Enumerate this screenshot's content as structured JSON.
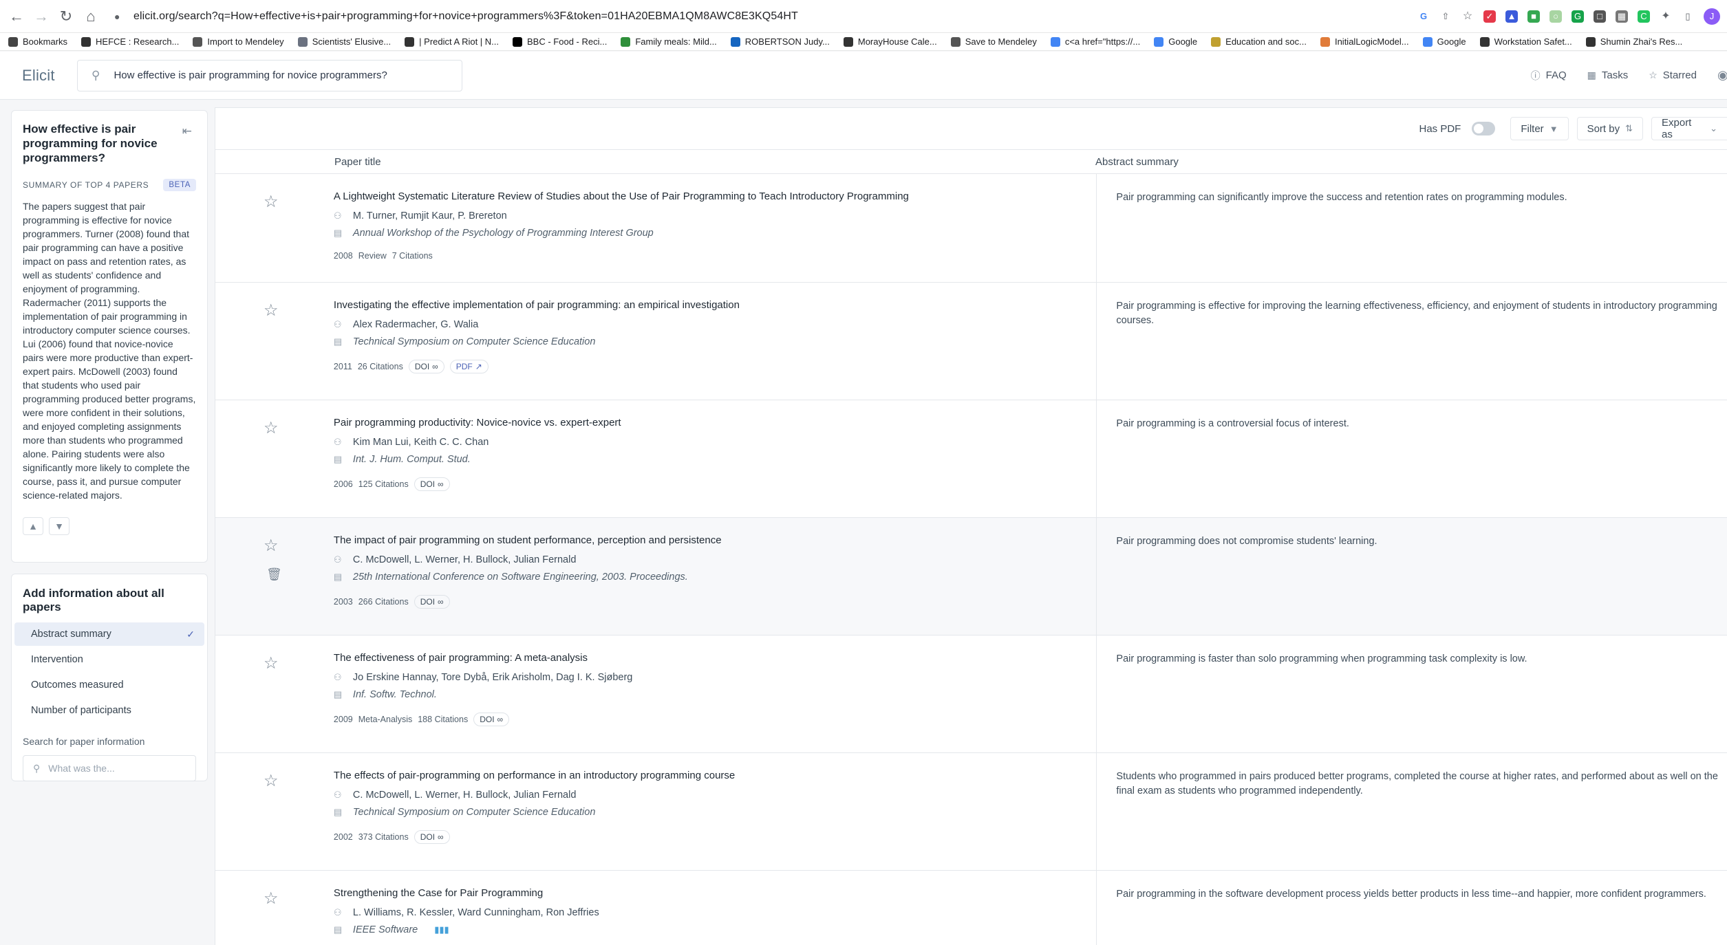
{
  "browser": {
    "url": "elicit.org/search?q=How+effective+is+pair+programming+for+novice+programmers%3F&token=01HA20EBMA1QM8AWC8E3KQ54HT",
    "profile_initial": "J",
    "bookmarks": [
      {
        "label": "Bookmarks",
        "icon": "star-icon"
      },
      {
        "label": "HEFCE : Research...",
        "icon": "folder-icon"
      },
      {
        "label": "Import to Mendeley",
        "icon": "mendeley-icon"
      },
      {
        "label": "Scientists' Elusive...",
        "icon": "ku-icon"
      },
      {
        "label": "| Predict A Riot | N...",
        "icon": "page-icon"
      },
      {
        "label": "BBC - Food - Reci...",
        "icon": "bbc-icon"
      },
      {
        "label": "Family meals: Mild...",
        "icon": "guardian-icon"
      },
      {
        "label": "ROBERTSON Judy...",
        "icon": "outlook-icon"
      },
      {
        "label": "MorayHouse Cale...",
        "icon": "calendar-icon"
      },
      {
        "label": "Save to Mendeley",
        "icon": "mendeley-icon"
      },
      {
        "label": "c<a href=\"https://...",
        "icon": "google-icon"
      },
      {
        "label": "Google",
        "icon": "google-icon"
      },
      {
        "label": "Education and soc...",
        "icon": "page-icon"
      },
      {
        "label": "InitialLogicModel...",
        "icon": "page-icon"
      },
      {
        "label": "Google",
        "icon": "google-icon"
      },
      {
        "label": "Workstation Safet...",
        "icon": "globe-icon"
      },
      {
        "label": "Shumin Zhai's Res...",
        "icon": "globe-icon"
      }
    ]
  },
  "header": {
    "logo": "Elicit",
    "search_query": "How effective is pair programming for novice programmers?",
    "links": [
      {
        "label": "FAQ",
        "icon": "help-icon"
      },
      {
        "label": "Tasks",
        "icon": "grid-icon"
      },
      {
        "label": "Starred",
        "icon": "star-icon"
      }
    ]
  },
  "sidebar": {
    "question": "How effective is pair programming for novice programmers?",
    "summary_label": "SUMMARY OF TOP 4 PAPERS",
    "beta_badge": "BETA",
    "summary_text": "The papers suggest that pair programming is effective for novice programmers. Turner (2008) found that pair programming can have a positive impact on pass and retention rates, as well as students' confidence and enjoyment of programming. Radermacher (2011) supports the implementation of pair programming in introductory computer science courses. Lui (2006) found that novice-novice pairs were more productive than expert-expert pairs. McDowell (2003) found that students who used pair programming produced better programs, were more confident in their solutions, and enjoyed completing assignments more than students who programmed alone. Pairing students were also significantly more likely to complete the course, pass it, and pursue computer science-related majors.",
    "add_info_title": "Add information about all papers",
    "columns": [
      {
        "label": "Abstract summary",
        "active": true
      },
      {
        "label": "Intervention",
        "active": false
      },
      {
        "label": "Outcomes measured",
        "active": false
      },
      {
        "label": "Number of participants",
        "active": false
      }
    ],
    "search_paper_label": "Search for paper information",
    "search_paper_placeholder": "What was the..."
  },
  "toolbar": {
    "has_pdf_label": "Has PDF",
    "has_pdf_on": false,
    "filter_label": "Filter",
    "sort_label": "Sort by",
    "export_label": "Export as"
  },
  "table": {
    "col_title": "Paper title",
    "col_summary": "Abstract summary",
    "rows": [
      {
        "title": "A Lightweight Systematic Literature Review of Studies about the Use of Pair Programming to Teach Introductory Programming",
        "authors": "M. Turner, Rumjit Kaur, P. Brereton",
        "venue": "Annual Workshop of the Psychology of Programming Interest Group",
        "year": "2008",
        "type": "Review",
        "citations": "7 Citations",
        "doi": "",
        "pdf": "",
        "summary": "Pair programming can significantly improve the success and retention rates on programming modules."
      },
      {
        "title": "Investigating the effective implementation of pair programming: an empirical investigation",
        "authors": "Alex Radermacher, G. Walia",
        "venue": "Technical Symposium on Computer Science Education",
        "year": "2011",
        "type": "",
        "citations": "26 Citations",
        "doi": "DOI",
        "pdf": "PDF",
        "summary": "Pair programming is effective for improving the learning effectiveness, efficiency, and enjoyment of students in introductory programming courses."
      },
      {
        "title": "Pair programming productivity: Novice-novice vs. expert-expert",
        "authors": "Kim Man Lui, Keith C. C. Chan",
        "venue": "Int. J. Hum. Comput. Stud.",
        "year": "2006",
        "type": "",
        "citations": "125 Citations",
        "doi": "DOI",
        "pdf": "",
        "summary": "Pair programming is a controversial focus of interest."
      },
      {
        "title": "The impact of pair programming on student performance, perception and persistence",
        "authors": "C. McDowell, L. Werner, H. Bullock, Julian Fernald",
        "venue": "25th International Conference on Software Engineering, 2003. Proceedings.",
        "year": "2003",
        "type": "",
        "citations": "266 Citations",
        "doi": "DOI",
        "pdf": "",
        "summary": "Pair programming does not compromise students' learning."
      },
      {
        "title": "The effectiveness of pair programming: A meta-analysis",
        "authors": "Jo Erskine Hannay, Tore Dybå, Erik Arisholm, Dag I. K. Sjøberg",
        "venue": "Inf. Softw. Technol.",
        "year": "2009",
        "type": "Meta-Analysis",
        "citations": "188 Citations",
        "doi": "DOI",
        "pdf": "",
        "summary": "Pair programming is faster than solo programming when programming task complexity is low."
      },
      {
        "title": "The effects of pair-programming on performance in an introductory programming course",
        "authors": "C. McDowell, L. Werner, H. Bullock, Julian Fernald",
        "venue": "Technical Symposium on Computer Science Education",
        "year": "2002",
        "type": "",
        "citations": "373 Citations",
        "doi": "DOI",
        "pdf": "",
        "summary": "Students who programmed in pairs produced better programs, completed the course at higher rates, and performed about as well on the final exam as students who programmed independently."
      },
      {
        "title": "Strengthening the Case for Pair Programming",
        "authors": "L. Williams, R. Kessler, Ward Cunningham, Ron Jeffries",
        "venue": "IEEE Software",
        "year": "",
        "type": "",
        "citations": "",
        "doi": "",
        "pdf": "",
        "summary": "Pair programming in the software development process yields better products in less time--and happier, more confident programmers."
      }
    ]
  }
}
